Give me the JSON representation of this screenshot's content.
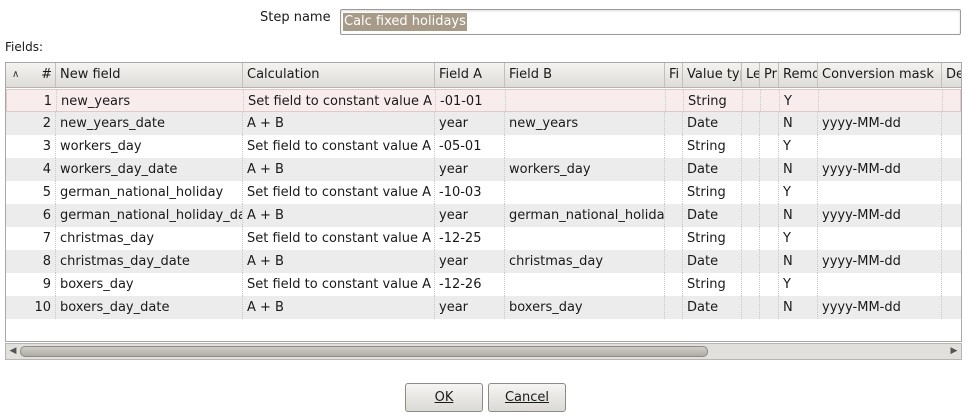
{
  "step": {
    "label": "Step name",
    "value": "Calc fixed holidays"
  },
  "fields_label": "Fields:",
  "table": {
    "columns": [
      "#",
      "New field",
      "Calculation",
      "Field A",
      "Field B",
      "Fi",
      "Value typ",
      "Le",
      "Pr",
      "Remo",
      "Conversion mask",
      "De"
    ],
    "rows": [
      [
        "1",
        "new_years",
        "Set field to constant value A",
        "-01-01",
        "",
        "",
        "String",
        "",
        "",
        "Y",
        "",
        ""
      ],
      [
        "2",
        "new_years_date",
        "A + B",
        "year",
        "new_years",
        "",
        "Date",
        "",
        "",
        "N",
        "yyyy-MM-dd",
        ""
      ],
      [
        "3",
        "workers_day",
        "Set field to constant value A",
        "-05-01",
        "",
        "",
        "String",
        "",
        "",
        "Y",
        "",
        ""
      ],
      [
        "4",
        "workers_day_date",
        "A + B",
        "year",
        "workers_day",
        "",
        "Date",
        "",
        "",
        "N",
        "yyyy-MM-dd",
        ""
      ],
      [
        "5",
        "german_national_holiday",
        "Set field to constant value A",
        "-10-03",
        "",
        "",
        "String",
        "",
        "",
        "Y",
        "",
        ""
      ],
      [
        "6",
        "german_national_holiday_da",
        "A + B",
        "year",
        "german_national_holida",
        "",
        "Date",
        "",
        "",
        "N",
        "yyyy-MM-dd",
        ""
      ],
      [
        "7",
        "christmas_day",
        "Set field to constant value A",
        "-12-25",
        "",
        "",
        "String",
        "",
        "",
        "Y",
        "",
        ""
      ],
      [
        "8",
        "christmas_day_date",
        "A + B",
        "year",
        "christmas_day",
        "",
        "Date",
        "",
        "",
        "N",
        "yyyy-MM-dd",
        ""
      ],
      [
        "9",
        "boxers_day",
        "Set field to constant value A",
        "-12-26",
        "",
        "",
        "String",
        "",
        "",
        "Y",
        "",
        ""
      ],
      [
        "10",
        "boxers_day_date",
        "A + B",
        "year",
        "boxers_day",
        "",
        "Date",
        "",
        "",
        "N",
        "yyyy-MM-dd",
        ""
      ]
    ]
  },
  "buttons": {
    "ok": "OK",
    "cancel": "Cancel"
  }
}
